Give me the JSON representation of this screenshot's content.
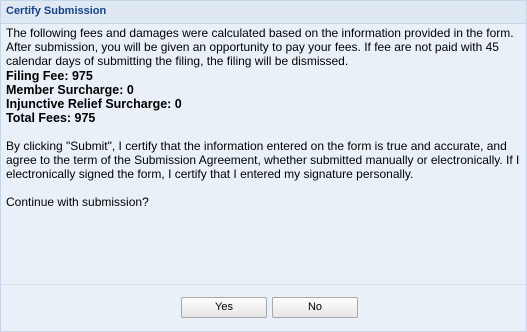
{
  "dialog": {
    "title": "Certify Submission",
    "intro": "The following fees and damages were calculated based on the information provided in the form. After submission, you will be given an opportunity to pay your fees. If fee are not paid with 45 calendar days of submitting the filing, the filing will be dismissed.",
    "fees": [
      "Filing Fee: 975",
      "Member Surcharge: 0",
      "Injunctive Relief Surcharge: 0",
      "Total Fees: 975"
    ],
    "certify_text": "By clicking \"Submit\", I certify that the information entered on the form is true and accurate, and agree to the term of the Submission Agreement, whether submitted manually or electronically. If I electronically signed the form, I certify that I entered my signature personally.",
    "question": "Continue with submission?",
    "buttons": {
      "yes": "Yes",
      "no": "No"
    }
  }
}
